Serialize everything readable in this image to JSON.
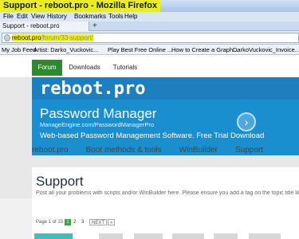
{
  "window": {
    "title": "Support - reboot.pro - Mozilla Firefox"
  },
  "menu": [
    "File",
    "Edit",
    "View",
    "History",
    "Bookmarks",
    "Tools",
    "Help"
  ],
  "tab": {
    "label": "Support - reboot.pro",
    "add": "+"
  },
  "url": {
    "host": "reboot.pro",
    "path": "/forum/33-support/"
  },
  "bookmarks": [
    "My Job Feed",
    "Artist: Darko_Vuckovic...",
    "Play Best Free Online ...",
    "How to Create a Graph...",
    "DarkoVuckovic_Invoice..."
  ],
  "site_nav": [
    "Forum",
    "Downloads",
    "Tutorials"
  ],
  "logo": "reboot.pro",
  "ad": {
    "title": "Password Manager",
    "url": "ManageEngine.com/PasswordManagerPro",
    "description": "Web-based Password Management Software. Free Trial Download",
    "arrow": "›"
  },
  "breadcrumb": [
    "reboot.pro",
    "Boot methods & tools",
    "WinBuilder",
    "Support"
  ],
  "breadcrumb_sep": "→",
  "forum": {
    "title": "Support",
    "description": "Post all your problems with scripts and/or WinBuilder here. Please ensure you add a tag on the topic title like [WE] whenever reason is unknown",
    "pager": {
      "label": "Page 1 of 15",
      "pages": [
        "1",
        "2",
        "3"
      ],
      "next": "NEXT",
      "next_arrow": "»"
    }
  }
}
